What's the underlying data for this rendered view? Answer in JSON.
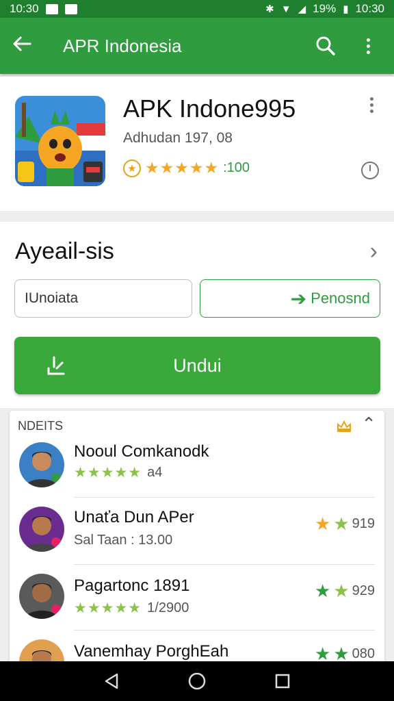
{
  "status_bar": {
    "time_left": "10:30",
    "battery": "19%",
    "time_right": "10:30"
  },
  "app_bar": {
    "title": "APR Indonesia"
  },
  "app": {
    "name": "APK Indone995",
    "developer": "Adhudan 197, 08",
    "rating_count": ":100"
  },
  "install": {
    "title": "Ayeail-sis",
    "input_value": "IUnoiata",
    "secondary_button": "Penosnd",
    "download_button": "Undui"
  },
  "reviews": {
    "header": "NDEITS",
    "items": [
      {
        "name": "Nooul Comkanodk",
        "meta": "a4",
        "stars": "★★★★★",
        "right_value": ""
      },
      {
        "name": "Unaťa Dun APer",
        "meta": "Sal Taan : 13.00",
        "stars": "",
        "right_value": "919"
      },
      {
        "name": "Pagartonc 1891",
        "meta": "1/2900",
        "stars": "★★★★★",
        "right_value": "929"
      },
      {
        "name": "Vanemhay PorghEah",
        "meta": "",
        "stars": "",
        "right_value": "080"
      }
    ]
  },
  "colors": {
    "primary": "#2e9c3f",
    "primary_dark": "#1e7f2e",
    "download": "#3aa83b",
    "star": "#f5a623",
    "star_green": "#8bc34a"
  }
}
